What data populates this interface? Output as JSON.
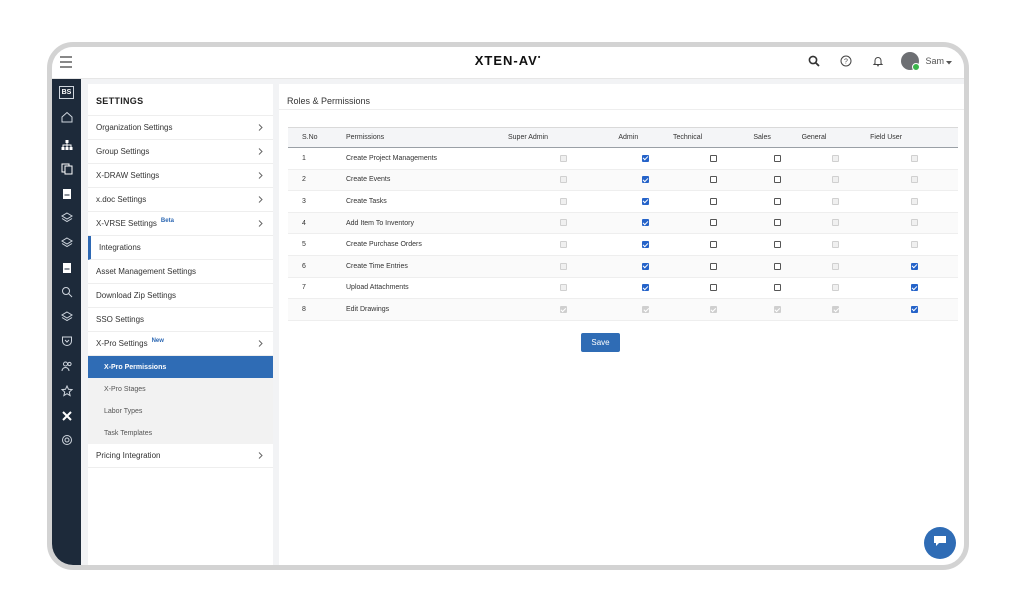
{
  "app": {
    "logo": "XTEN-AV",
    "user_name": "Sam",
    "rail_badge": "BS"
  },
  "settings": {
    "title": "SETTINGS",
    "items": [
      {
        "label": "Organization Settings",
        "chevron": true
      },
      {
        "label": "Group Settings",
        "chevron": true
      },
      {
        "label": "X-DRAW Settings",
        "chevron": true
      },
      {
        "label": "x.doc Settings",
        "chevron": true
      },
      {
        "label": "X-VRSE Settings",
        "tag": "Beta",
        "chevron": true
      },
      {
        "label": "Integrations",
        "chevron": false,
        "active": true
      },
      {
        "label": "Asset Management Settings",
        "chevron": false
      },
      {
        "label": "Download Zip Settings",
        "chevron": false
      },
      {
        "label": "SSO Settings",
        "chevron": false
      },
      {
        "label": "X-Pro Settings",
        "tag": "New",
        "chevron": true
      }
    ],
    "sub_items": [
      {
        "label": "X-Pro Permissions",
        "selected": true
      },
      {
        "label": "X-Pro Stages"
      },
      {
        "label": "Labor Types"
      },
      {
        "label": "Task Templates"
      }
    ],
    "last_item": {
      "label": "Pricing Integration",
      "chevron": true
    }
  },
  "main": {
    "title": "Roles & Permissions",
    "columns": [
      "S.No",
      "Permissions",
      "Super Admin",
      "Admin",
      "Technical",
      "Sales",
      "General",
      "Field User"
    ],
    "rows": [
      {
        "sno": "1",
        "permission": "Create Project Managements",
        "states": [
          "dis",
          "chk",
          "emp",
          "emp",
          "dis",
          "dis"
        ]
      },
      {
        "sno": "2",
        "permission": "Create Events",
        "states": [
          "dis",
          "chk",
          "emp",
          "emp",
          "dis",
          "dis"
        ]
      },
      {
        "sno": "3",
        "permission": "Create Tasks",
        "states": [
          "dis",
          "chk",
          "emp",
          "emp",
          "dis",
          "dis"
        ]
      },
      {
        "sno": "4",
        "permission": "Add Item To Inventory",
        "states": [
          "dis",
          "chk",
          "emp",
          "emp",
          "dis",
          "dis"
        ]
      },
      {
        "sno": "5",
        "permission": "Create Purchase Orders",
        "states": [
          "dis",
          "chk",
          "emp",
          "emp",
          "dis",
          "dis"
        ]
      },
      {
        "sno": "6",
        "permission": "Create Time Entries",
        "states": [
          "dis",
          "chk",
          "emp",
          "emp",
          "dis",
          "chk"
        ]
      },
      {
        "sno": "7",
        "permission": "Upload Attachments",
        "states": [
          "dis",
          "chk",
          "emp",
          "emp",
          "dis",
          "chk"
        ]
      },
      {
        "sno": "8",
        "permission": "Edit Drawings",
        "states": [
          "dchk",
          "dchk",
          "dchk",
          "dchk",
          "dchk",
          "chk"
        ]
      }
    ],
    "save_label": "Save"
  },
  "icons": {
    "topbar": [
      "hamburger-icon",
      "search-icon",
      "help-icon",
      "bell-icon",
      "avatar",
      "chevron-down-icon"
    ],
    "rail": [
      "home-icon",
      "hierarchy-icon",
      "copy-icon",
      "document-icon",
      "layers-icon",
      "layers-icon",
      "document-icon",
      "search-icon",
      "layers-icon",
      "shield-icon",
      "users-icon",
      "star-icon",
      "tools-icon",
      "settings-icon"
    ],
    "chat": "chat-icon"
  },
  "colors": {
    "accent": "#2f6cb5",
    "rail": "#1d2a3a",
    "checkbox": "#2563c9"
  }
}
